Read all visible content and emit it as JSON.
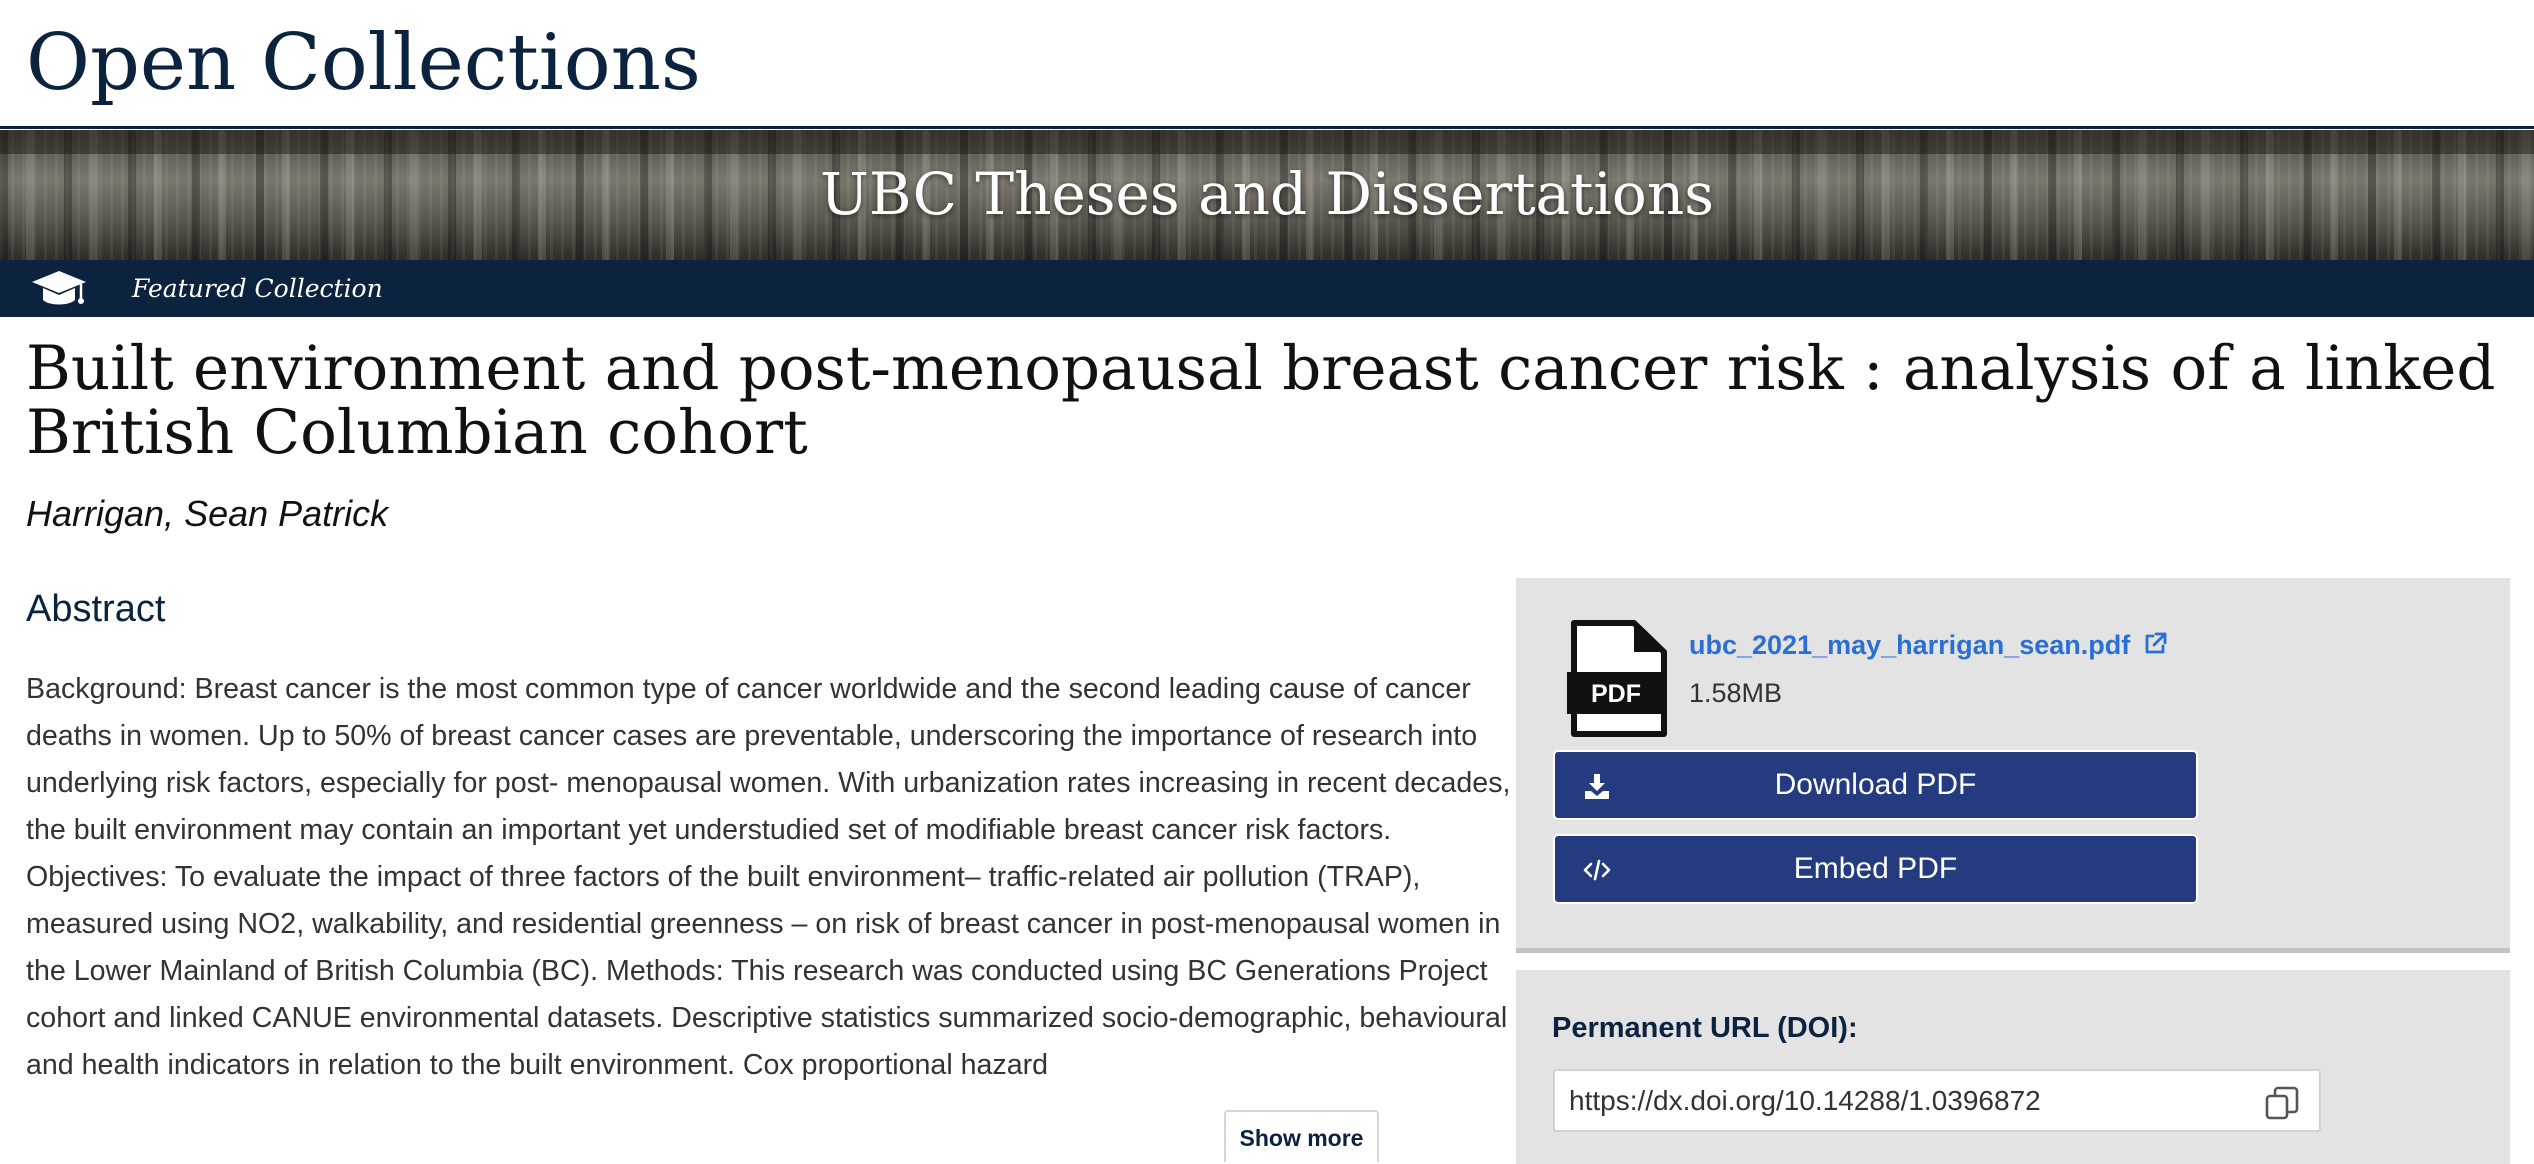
{
  "header": {
    "site_title": "Open Collections"
  },
  "banner": {
    "title": "UBC Theses and Dissertations"
  },
  "featured_bar": {
    "icon": "graduation-cap-icon",
    "label": "Featured Collection"
  },
  "item": {
    "title": "Built environment and post-menopausal breast cancer risk : analysis of a linked British Columbian cohort",
    "author": "Harrigan, Sean Patrick"
  },
  "abstract": {
    "heading": "Abstract",
    "text": "Background: Breast cancer is the most common type of cancer worldwide and the second leading cause of cancer deaths in women. Up to 50% of breast cancer cases are preventable, underscoring the importance of research into underlying risk factors, especially for post- menopausal women. With urbanization rates increasing in recent decades, the built environment may contain an important yet understudied set of modifiable breast cancer risk factors. Objectives: To evaluate the impact of three factors of the built environment– traffic-related air pollution (TRAP), measured using NO2, walkability, and residential greenness – on risk of breast cancer in post-menopausal women in the Lower Mainland of British Columbia (BC). Methods: This research was conducted using BC Generations Project cohort and linked CANUE environmental datasets. Descriptive statistics summarized socio-demographic, behavioural and health indicators in relation to the built environment. Cox proportional hazard",
    "show_more_label": "Show more"
  },
  "file_panel": {
    "file_icon": "pdf-file-icon",
    "file_icon_text": "PDF",
    "file_name": "ubc_2021_may_harrigan_sean.pdf",
    "file_size": "1.58MB",
    "download_label": "Download PDF",
    "download_icon": "download-icon",
    "embed_label": "Embed PDF",
    "embed_icon": "code-icon"
  },
  "doi": {
    "label": "Permanent URL (DOI):",
    "value": "https://dx.doi.org/10.14288/1.0396872",
    "copy_icon": "copy-icon"
  },
  "colors": {
    "ubc_navy": "#0c2340",
    "button_blue": "#253b80",
    "link_blue": "#2a6fd6",
    "panel_gray": "#e3e3e3"
  }
}
